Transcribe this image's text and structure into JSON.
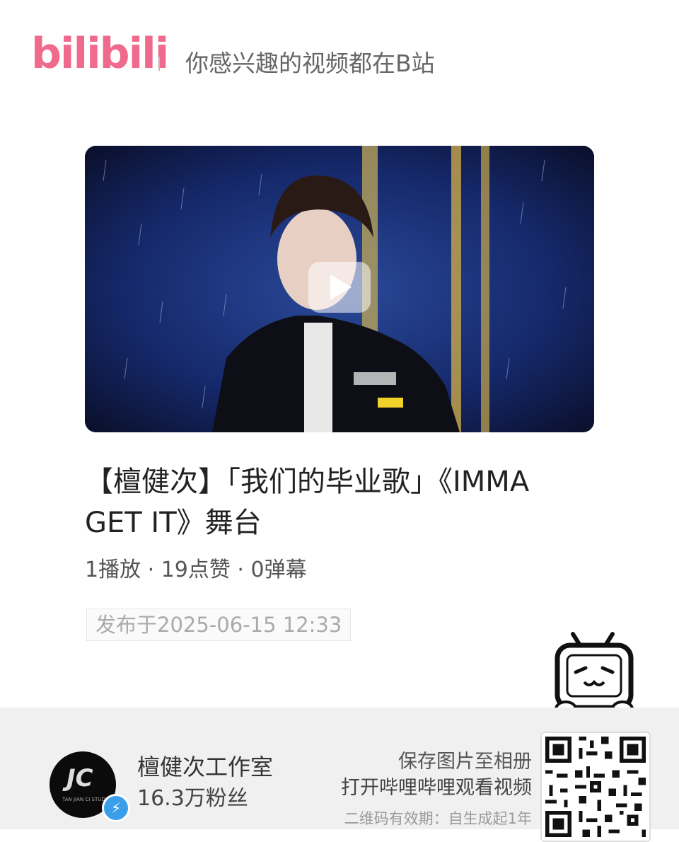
{
  "header": {
    "logo_text": "bilibili",
    "slogan": "你感兴趣的视频都在B站"
  },
  "video": {
    "title": "【檀健次】「我们的毕业歌」《IMMA GET IT》舞台",
    "stats": "1播放 · 19点赞 · 0弹幕",
    "publish_date": "发布于2025-06-15 12:33",
    "play_icon": "play-icon"
  },
  "uploader": {
    "name": "檀健次工作室",
    "fans": "16.3万粉丝",
    "avatar_mark": "JC",
    "avatar_caption": "TAN JIAN CI STUDIO",
    "verified_icon": "lightning-icon"
  },
  "share": {
    "line1": "保存图片至相册",
    "line2": "打开哔哩哔哩观看视频",
    "line3": "二维码有效期：自生成起1年"
  },
  "colors": {
    "brand_pink": "#f06a8e",
    "verify_blue": "#3a9ee8"
  }
}
